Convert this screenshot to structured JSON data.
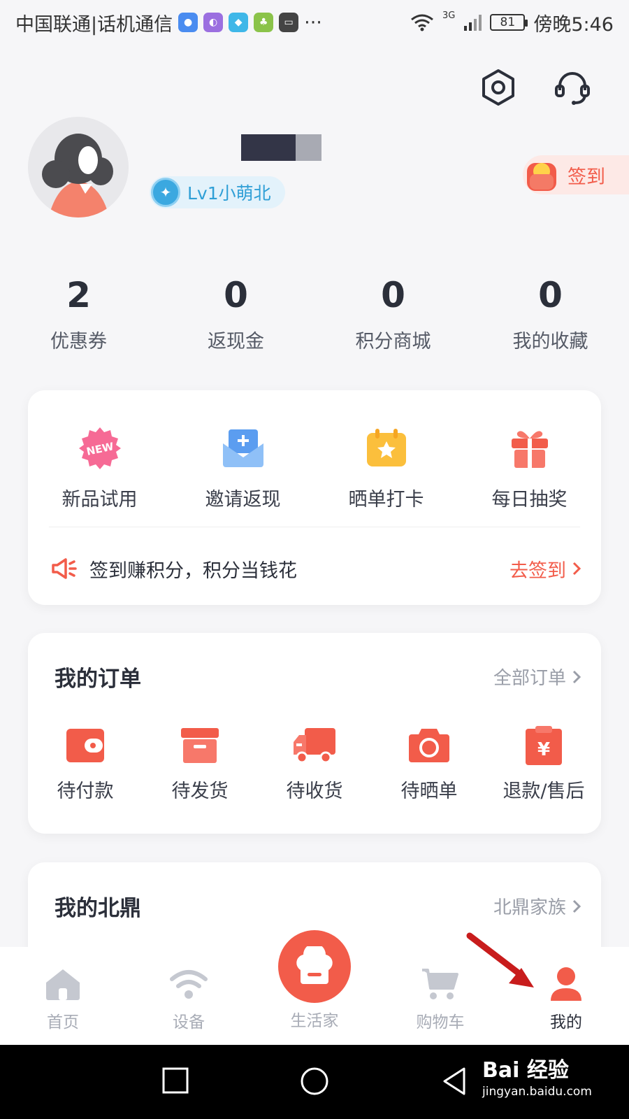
{
  "status_bar": {
    "carrier": "中国联通|话机通信",
    "network": "3G",
    "battery": "81",
    "time": "傍晚5:46"
  },
  "top_icons": [
    "settings-icon",
    "customer-service-icon"
  ],
  "profile": {
    "level": "Lv1小萌北",
    "signin_label": "签到"
  },
  "stats": [
    {
      "value": "2",
      "label": "优惠券"
    },
    {
      "value": "0",
      "label": "返现金"
    },
    {
      "value": "0",
      "label": "积分商城"
    },
    {
      "value": "0",
      "label": "我的收藏"
    }
  ],
  "services": [
    {
      "label": "新品试用",
      "icon": "new-badge-icon",
      "badge": "NEW"
    },
    {
      "label": "邀请返现",
      "icon": "envelope-icon"
    },
    {
      "label": "晒单打卡",
      "icon": "calendar-star-icon"
    },
    {
      "label": "每日抽奖",
      "icon": "gift-icon"
    }
  ],
  "tip": {
    "text": "签到赚积分，积分当钱花",
    "link": "去签到"
  },
  "orders": {
    "title": "我的订单",
    "more": "全部订单",
    "items": [
      {
        "label": "待付款",
        "icon": "wallet-icon"
      },
      {
        "label": "待发货",
        "icon": "box-icon"
      },
      {
        "label": "待收货",
        "icon": "truck-icon"
      },
      {
        "label": "待晒单",
        "icon": "camera-icon"
      },
      {
        "label": "退款/售后",
        "icon": "refund-icon"
      }
    ]
  },
  "beiding": {
    "title": "我的北鼎",
    "more": "北鼎家族"
  },
  "tabbar": [
    {
      "label": "首页",
      "icon": "home-icon"
    },
    {
      "label": "设备",
      "icon": "wifi-icon"
    },
    {
      "label": "生活家",
      "icon": "chef-hat-icon"
    },
    {
      "label": "购物车",
      "icon": "cart-icon"
    },
    {
      "label": "我的",
      "icon": "user-icon",
      "active": true
    }
  ],
  "watermark": {
    "brand": "Bai 经验",
    "url": "jingyan.baidu.com"
  },
  "colors": {
    "accent": "#f25c4a",
    "text": "#2b2f3a",
    "muted": "#a8acb6",
    "level": "#2f9fd6"
  }
}
